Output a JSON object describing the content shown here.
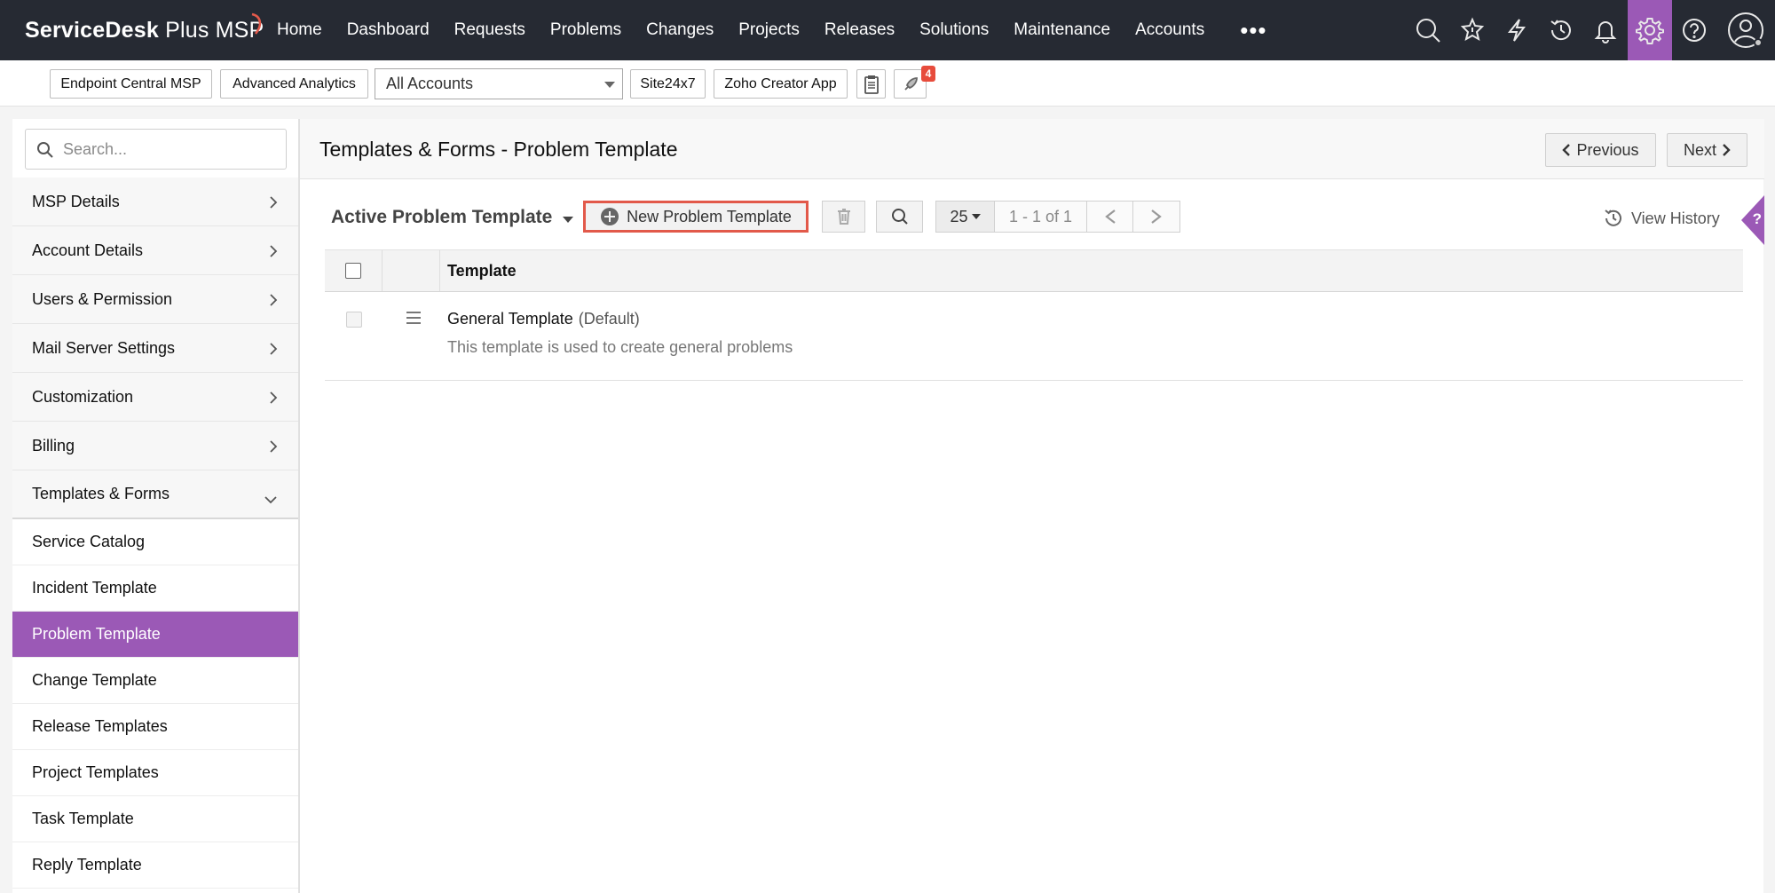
{
  "app": {
    "name": "ServiceDesk Plus MSP",
    "name_main": "ServiceDesk",
    "name_rest": " Plus MSP"
  },
  "nav": {
    "items": [
      "Home",
      "Dashboard",
      "Requests",
      "Problems",
      "Changes",
      "Projects",
      "Releases",
      "Solutions",
      "Maintenance",
      "Accounts"
    ],
    "more": "•••",
    "icons": [
      "search-icon",
      "launch-icon",
      "lightning-icon",
      "history-icon",
      "bell-icon",
      "gear-icon",
      "help-icon",
      "user-avatar-icon"
    ],
    "active_icon": "gear-icon",
    "accent": "#9b59b6"
  },
  "quickbar": {
    "endpoint": "Endpoint Central MSP",
    "analytics": "Advanced Analytics",
    "account_select": "All Accounts",
    "site": "Site24x7",
    "creator": "Zoho Creator App",
    "icons": [
      "clipboard-icon",
      "rocket-icon"
    ],
    "notification_count": "4"
  },
  "sidebar": {
    "search_placeholder": "Search...",
    "menu": [
      "MSP Details",
      "Account Details",
      "Users & Permission",
      "Mail Server Settings",
      "Customization",
      "Billing"
    ],
    "open_section": "Templates & Forms",
    "sub_items": [
      "Service Catalog",
      "Incident Template",
      "Problem Template",
      "Change Template",
      "Release Templates",
      "Project Templates",
      "Task Template",
      "Reply Template"
    ],
    "active_sub": "Problem Template"
  },
  "main": {
    "title": "Templates & Forms - Problem Template",
    "previous": "Previous",
    "next": "Next",
    "view": "Active Problem Template",
    "new_button": "New Problem Template",
    "page_size": "25",
    "range": "1 - 1 of 1",
    "view_history": "View History",
    "help": "?",
    "column": "Template",
    "rows": [
      {
        "name": "General Template",
        "tag": "(Default)",
        "description": "This template is used to create general problems"
      }
    ]
  },
  "colors": {
    "topbar": "#262a33",
    "accent": "#9b59b6",
    "highlight": "#e2594a",
    "badge": "#e74c3c"
  }
}
